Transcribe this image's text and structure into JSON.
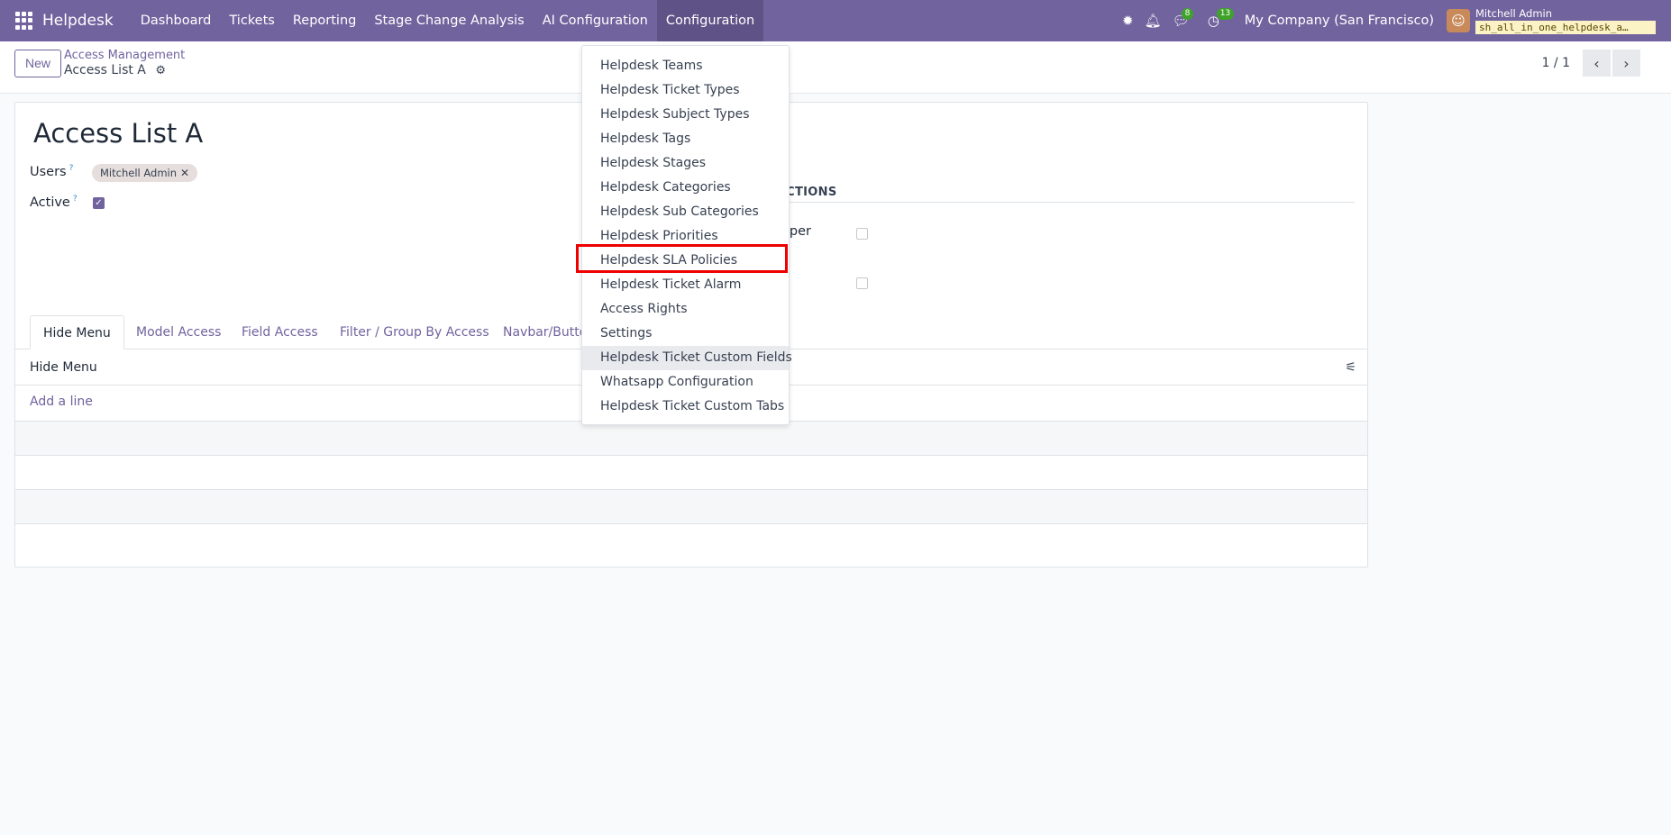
{
  "navbar": {
    "app_name": "Helpdesk",
    "menu": [
      "Dashboard",
      "Tickets",
      "Reporting",
      "Stage Change Analysis",
      "AI Configuration",
      "Configuration"
    ],
    "active_menu": "Configuration",
    "messages_badge": "8",
    "activities_badge": "13",
    "company": "My Company (San Francisco)",
    "user_name": "Mitchell Admin",
    "database": "sh_all_in_one_helpdesk_a…",
    "bg_color": "#71639e"
  },
  "control": {
    "new_label": "New",
    "breadcrumb": "Access Management",
    "record_title": "Access List A",
    "pager": "1 / 1"
  },
  "form": {
    "title": "Access List A",
    "users_label": "Users",
    "help_mark": "?",
    "user_tag": "Mitchell Admin",
    "active_label": "Active",
    "active_checked": true,
    "section_title": "ICTIONS",
    "partial_label": "oper"
  },
  "tabs": [
    "Hide Menu",
    "Model Access",
    "Field Access",
    "Filter / Group By Access",
    "Navbar/Butto"
  ],
  "table": {
    "header": "Hide Menu",
    "add_line": "Add a line"
  },
  "dropdown": {
    "items": [
      "Helpdesk Teams",
      "Helpdesk Ticket Types",
      "Helpdesk Subject Types",
      "Helpdesk Tags",
      "Helpdesk Stages",
      "Helpdesk Categories",
      "Helpdesk Sub Categories",
      "Helpdesk Priorities",
      "Helpdesk SLA Policies",
      "Helpdesk Ticket Alarm",
      "Access Rights",
      "Settings",
      "Helpdesk Ticket Custom Fields",
      "Whatsapp Configuration",
      "Helpdesk Ticket Custom Tabs"
    ],
    "highlighted_item": "Helpdesk SLA Policies",
    "hovered_item": "Helpdesk Ticket Custom Fields"
  }
}
